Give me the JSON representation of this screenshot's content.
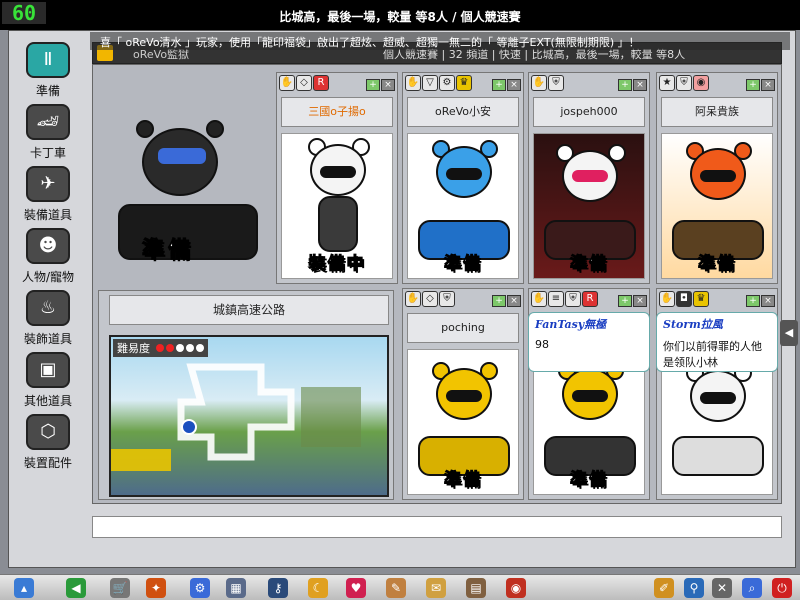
{
  "fps": "60",
  "window_title": "比城高，最後一場，較量 等8人 / 個人競速賽",
  "notice": "喜「 oReVo清水 」玩家，使用「龍印福袋」啟出了超炫、超威、超獨一無二的「 等離子EXT(無限制期限) 」！",
  "infobar": {
    "owner": "oReVo監獄",
    "mode": "個人競速賽 | 32 頻道 | 快速 | 比城高，最後一場，較量 等8人"
  },
  "sidebar": [
    {
      "label": "準備",
      "icon": "ready-icon"
    },
    {
      "label": "卡丁車",
      "icon": "kart-icon"
    },
    {
      "label": "裝備道具",
      "icon": "equipment-icon"
    },
    {
      "label": "人物/寵物",
      "icon": "character-pet-icon"
    },
    {
      "label": "裝飾道具",
      "icon": "decoration-icon"
    },
    {
      "label": "其他道具",
      "icon": "other-items-icon"
    },
    {
      "label": "裝置配件",
      "icon": "parts-icon"
    }
  ],
  "host": {
    "status": "準備"
  },
  "players": [
    {
      "name": "三國o子揚o",
      "status": "裝備中",
      "name_color": "#e06a00"
    },
    {
      "name": "oReVo小安",
      "status": "準備",
      "name_color": "#222222"
    },
    {
      "name": "jospeh000",
      "status": "準備",
      "name_color": "#222222"
    },
    {
      "name": "阿呆貴族",
      "status": "準備",
      "name_color": "#222222"
    },
    {
      "name": "poching",
      "status": "準備",
      "name_color": "#222222"
    },
    {
      "name": "FanTasy無極",
      "status": "準備",
      "name_color": "#222222"
    },
    {
      "name": "Storm拉風",
      "status": "",
      "name_color": "#222222"
    }
  ],
  "track": {
    "name": "城鎮高速公路",
    "difficulty_label": "難易度",
    "difficulty_level": 2,
    "difficulty_max": 5
  },
  "chat_bubbles": [
    {
      "who": "FanTasy無極",
      "msg": "98"
    },
    {
      "who": "Storm拉風",
      "msg": "你们以前得罪的人他是领队小林"
    }
  ],
  "chat_input": {
    "value": ""
  },
  "colors": {
    "ready_text": "#ffffff",
    "accent": "#f2b600",
    "topbar": "#000000"
  }
}
